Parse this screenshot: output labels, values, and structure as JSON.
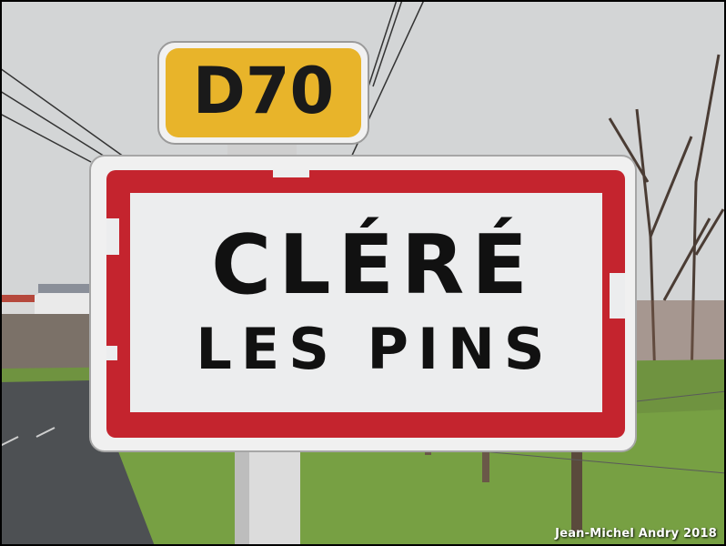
{
  "route_sign": {
    "text": "D70",
    "color": "#e8b42a"
  },
  "town_sign": {
    "name": "CLÉRÉ",
    "subtitle": "LES PINS",
    "border_color": "#c4242e",
    "background": "#ecedee"
  },
  "photo_credit": "Jean-Michel Andry 2018"
}
